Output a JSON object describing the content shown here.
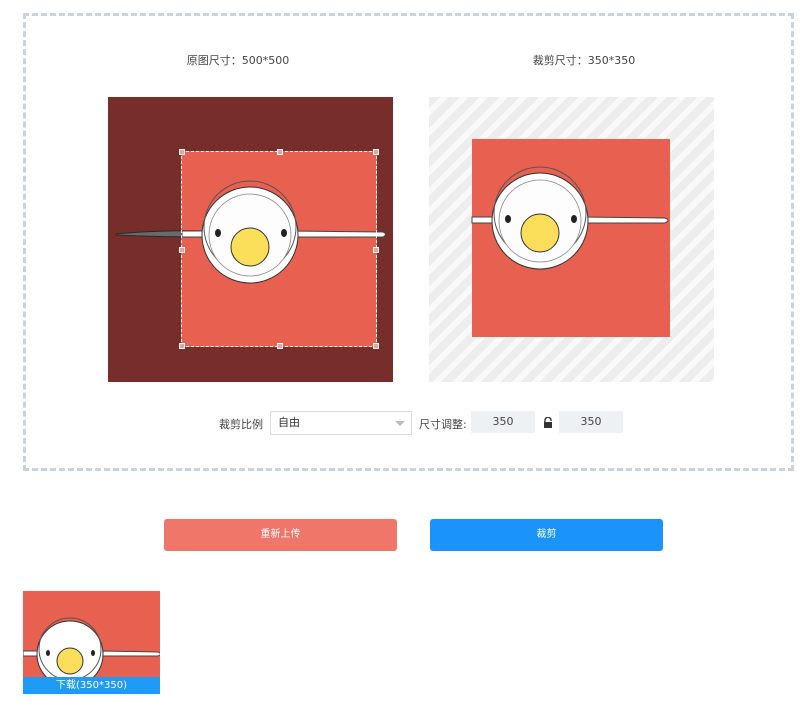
{
  "original_size_label": "原图尺寸：500*500",
  "crop_size_label": "裁剪尺寸：350*350",
  "controls": {
    "ratio_label": "裁剪比例",
    "ratio_value": "自由",
    "size_adjust_label": "尺寸调整:",
    "width_value": "350",
    "height_value": "350"
  },
  "buttons": {
    "reupload": "重新上传",
    "crop": "裁剪"
  },
  "thumbnail": {
    "download_label": "下载(350*350)"
  },
  "colors": {
    "accent_blue": "#1a94fb",
    "reupload_red": "#f1766a",
    "image_red": "#e8604f",
    "dim_overlay": "#772e2b"
  }
}
